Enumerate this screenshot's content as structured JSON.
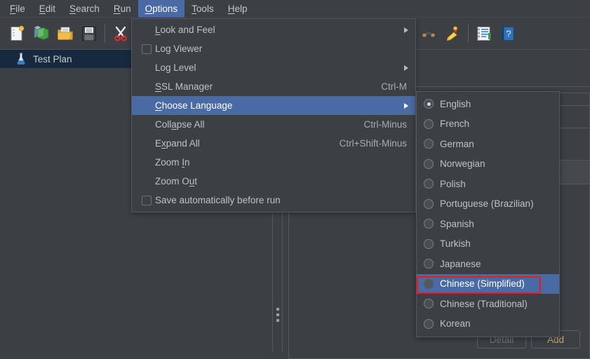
{
  "app": {
    "background_color": "#3c4044",
    "accent_color": "#4a6aa5",
    "annotation_color": "#f01818"
  },
  "menubar": {
    "items": [
      {
        "label": "File",
        "mnemonic": "F",
        "active": false
      },
      {
        "label": "Edit",
        "mnemonic": "E",
        "active": false
      },
      {
        "label": "Search",
        "mnemonic": "S",
        "active": false
      },
      {
        "label": "Run",
        "mnemonic": "R",
        "active": false
      },
      {
        "label": "Options",
        "mnemonic": "O",
        "active": true
      },
      {
        "label": "Tools",
        "mnemonic": "T",
        "active": false
      },
      {
        "label": "Help",
        "mnemonic": "H",
        "active": false
      }
    ]
  },
  "toolbar": {
    "left_buttons": [
      {
        "icon": "new-document-icon"
      },
      {
        "icon": "open-templates-icon"
      },
      {
        "icon": "open-folder-icon"
      },
      {
        "icon": "save-floppy-icon"
      },
      {
        "icon": "cut-scissors-icon"
      }
    ],
    "right_buttons": [
      {
        "icon": "search-binoculars-icon"
      },
      {
        "icon": "clear-broom-icon"
      },
      {
        "icon": "function-helper-icon"
      },
      {
        "icon": "help-book-icon"
      }
    ]
  },
  "tree": {
    "root": {
      "label": "Test Plan",
      "icon": "test-plan-flask-icon",
      "selected": true
    }
  },
  "options_menu": {
    "items": [
      {
        "label": "Look and Feel",
        "mnemonic": "L",
        "type": "submenu",
        "accel": "",
        "selected": false
      },
      {
        "label": "Log Viewer",
        "mnemonic": "",
        "type": "checkbox",
        "accel": "",
        "selected": false,
        "checked": false
      },
      {
        "label": "Log Level",
        "mnemonic": "",
        "type": "submenu",
        "accel": "",
        "selected": false
      },
      {
        "label": "SSL Manager",
        "mnemonic": "S",
        "type": "item",
        "accel": "Ctrl-M",
        "selected": false
      },
      {
        "label": "Choose Language",
        "mnemonic": "C",
        "type": "submenu",
        "accel": "",
        "selected": true
      },
      {
        "label": "Collapse All",
        "mnemonic": "a",
        "type": "item",
        "accel": "Ctrl-Minus",
        "selected": false
      },
      {
        "label": "Expand All",
        "mnemonic": "x",
        "type": "item",
        "accel": "Ctrl+Shift-Minus",
        "selected": false
      },
      {
        "label": "Zoom In",
        "mnemonic": "I",
        "type": "item",
        "accel": "",
        "selected": false
      },
      {
        "label": "Zoom Out",
        "mnemonic": "u",
        "type": "item",
        "accel": "",
        "selected": false
      },
      {
        "label": "Save automatically before run",
        "mnemonic": "",
        "type": "checkbox",
        "accel": "",
        "selected": false,
        "checked": false
      }
    ]
  },
  "language_submenu": {
    "items": [
      {
        "label": "English",
        "checked": true,
        "highlighted": false
      },
      {
        "label": "French",
        "checked": false,
        "highlighted": false
      },
      {
        "label": "German",
        "checked": false,
        "highlighted": false
      },
      {
        "label": "Norwegian",
        "checked": false,
        "highlighted": false
      },
      {
        "label": "Polish",
        "checked": false,
        "highlighted": false
      },
      {
        "label": "Portuguese (Brazilian)",
        "checked": false,
        "highlighted": false
      },
      {
        "label": "Spanish",
        "checked": false,
        "highlighted": false
      },
      {
        "label": "Turkish",
        "checked": false,
        "highlighted": false
      },
      {
        "label": "Japanese",
        "checked": false,
        "highlighted": false
      },
      {
        "label": "Chinese (Simplified)",
        "checked": false,
        "highlighted": true
      },
      {
        "label": "Chinese (Traditional)",
        "checked": false,
        "highlighted": false
      },
      {
        "label": "Korean",
        "checked": false,
        "highlighted": false
      }
    ]
  },
  "buttons": {
    "detail": {
      "label": "Detail",
      "enabled": false
    },
    "add": {
      "label": "Add",
      "enabled": true
    }
  }
}
